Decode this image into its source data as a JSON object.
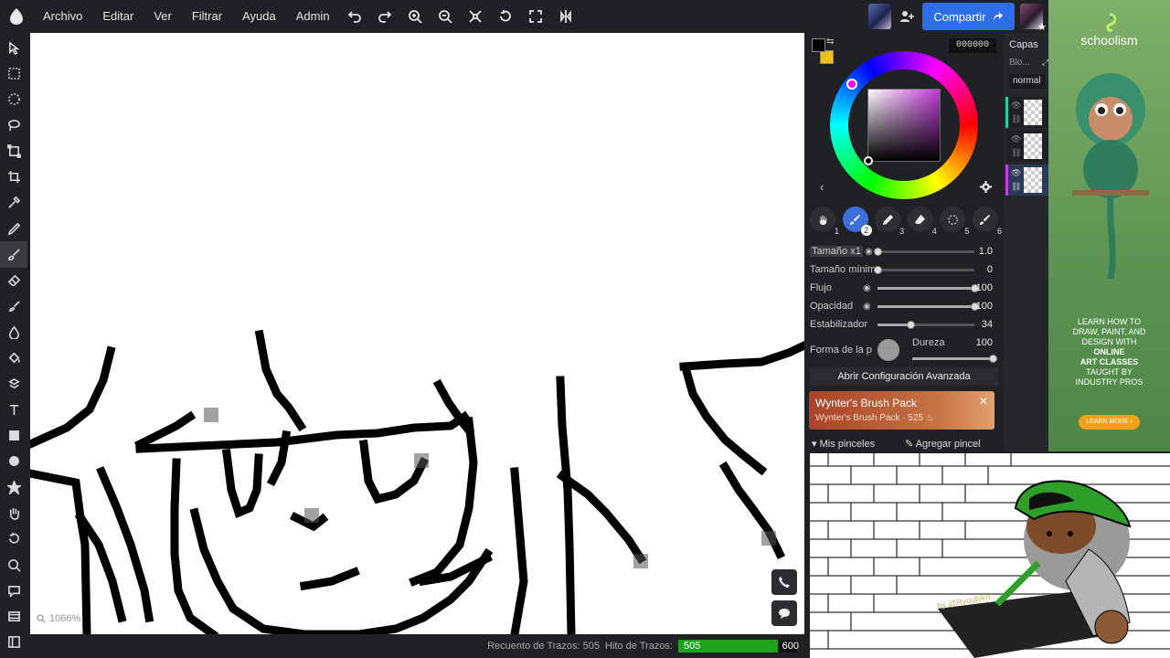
{
  "menu": {
    "items": [
      "Archivo",
      "Editar",
      "Ver",
      "Filtrar",
      "Ayuda",
      "Admin"
    ]
  },
  "toolbar": {
    "icons": [
      "undo-icon",
      "redo-icon",
      "zoom-in-icon",
      "zoom-out-icon",
      "fit-icon",
      "rotate-icon",
      "fullscreen-icon",
      "flip-icon"
    ],
    "share_label": "Compartir"
  },
  "color": {
    "hex": "000000",
    "foreground": "#000000",
    "background": "#f0c020"
  },
  "brushes": [
    {
      "num": "1",
      "icon": "hand-icon"
    },
    {
      "num": "2",
      "icon": "brush-icon"
    },
    {
      "num": "3",
      "icon": "pen-icon"
    },
    {
      "num": "4",
      "icon": "eraser-icon"
    },
    {
      "num": "5",
      "icon": "lasso-icon"
    },
    {
      "num": "6",
      "icon": "brush-icon"
    }
  ],
  "settings": {
    "size_label": "Tamaño x1",
    "size_value": "1.0",
    "size_level": 0,
    "minsize_label": "Tamaño mínimo",
    "minsize_value": "0",
    "minsize_level": 0,
    "flow_label": "Flujo",
    "flow_value": "100",
    "flow_level": 1,
    "opacity_label": "Opacidad",
    "opacity_value": "100",
    "opacity_level": 1,
    "stab_label": "Estabilizador",
    "stab_value": "34",
    "stab_level": 0.34,
    "shape_label": "Forma de la punta",
    "hardness_label": "Dureza",
    "hardness_value": "100",
    "hardness_level": 1,
    "advanced_label": "Abrir Configuración Avanzada"
  },
  "promo": {
    "title": "Wynter's Brush Pack",
    "subtitle": "Wynter's Brush Pack · 525 ♨",
    "close": "✕"
  },
  "brush_panel": {
    "mine_label": "Mis pinceles",
    "add_label": "Agregar pincel"
  },
  "layers": {
    "title": "Capas",
    "blend_label": "Blo...",
    "mode": "normal",
    "items": [
      {
        "stripe": "#28d0a0"
      },
      {
        "stripe": "#26272b"
      },
      {
        "stripe": "#c040e0"
      }
    ]
  },
  "status": {
    "zoom": "1066%",
    "stroke_count_label": "Recuento de Trazos: 505",
    "milestone_label": "Hito de Trazos:",
    "current": "505",
    "goal": "600",
    "progress": 0.84
  },
  "ad": {
    "brand": "schoolism",
    "copy_lines": [
      "LEARN HOW TO",
      "DRAW, PAINT, AND",
      "DESIGN WITH",
      "ONLINE",
      "ART CLASSES",
      "TAUGHT BY",
      "INDUSTRY PROS"
    ],
    "cta": "LEARN MORE ›"
  },
  "artwork": {
    "signature": "by @Ryuuhiko..."
  }
}
